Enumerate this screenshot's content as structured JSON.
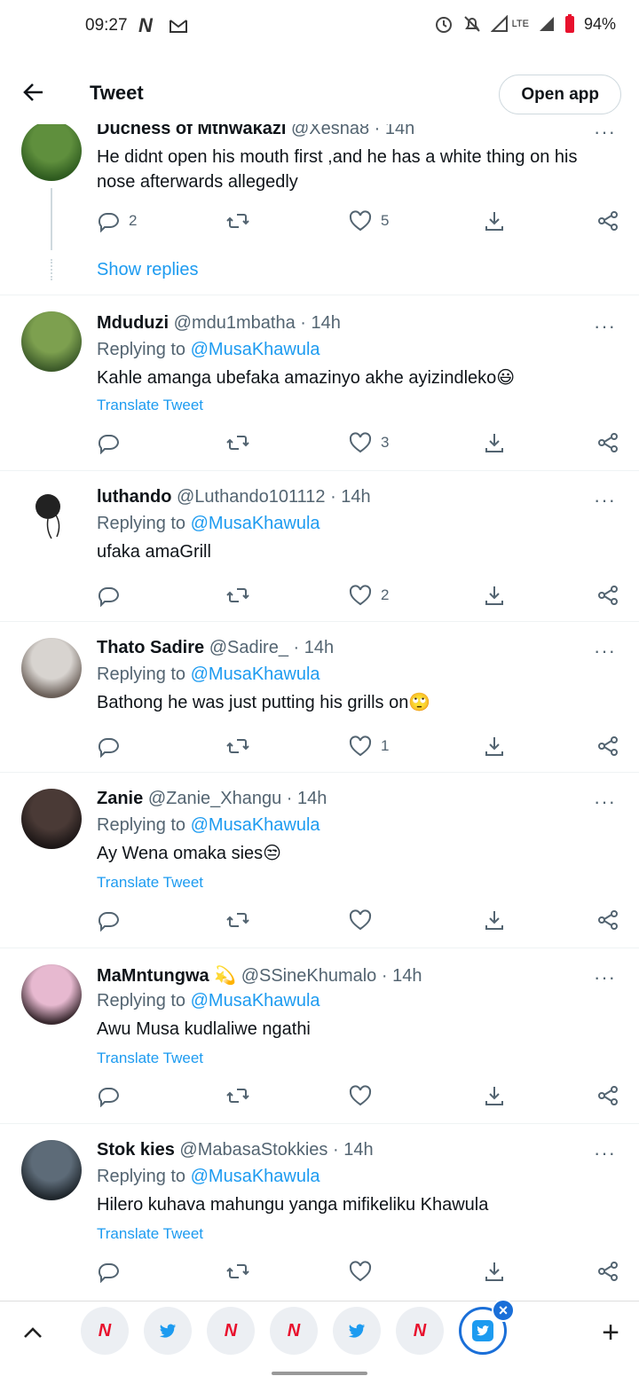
{
  "status_bar": {
    "time": "09:27",
    "app_icons": [
      "news-app-icon",
      "gmail-icon"
    ],
    "network": "LTE",
    "battery": "94%"
  },
  "header": {
    "title": "Tweet",
    "open_app_label": "Open app"
  },
  "tweets": [
    {
      "name": "Duchess of Mthwakazi",
      "handle": "@Xesha8",
      "time": "· 14h",
      "replying_prefix": "",
      "replying_to": "",
      "text": "He didnt open his mouth  first ,and he has a white thing on his nose afterwards allegedly",
      "translate": "",
      "replies": "2",
      "retweets": "",
      "likes": "5",
      "show_replies": "Show replies",
      "avatar_colors": [
        "#5f8f3d",
        "#2e5b1f"
      ]
    },
    {
      "name": "Mduduzi",
      "handle": "@mdu1mbatha",
      "time": "· 14h",
      "replying_prefix": "Replying to",
      "replying_to": "@MusaKhawula",
      "text": "Kahle amanga ubefaka amazinyo akhe ayizindleko😃",
      "translate": "Translate Tweet",
      "replies": "",
      "retweets": "",
      "likes": "3",
      "avatar_colors": [
        "#7da04f",
        "#3d5b2a"
      ]
    },
    {
      "name": "luthando",
      "handle": "@Luthando101112",
      "time": "· 14h",
      "replying_prefix": "Replying to",
      "replying_to": "@MusaKhawula",
      "text": "ufaka amaGrill",
      "translate": "",
      "replies": "",
      "retweets": "",
      "likes": "2",
      "avatar_colors": [
        "#ffffff",
        "#222222"
      ]
    },
    {
      "name": "Thato Sadire",
      "handle": "@Sadire_",
      "time": "· 14h",
      "replying_prefix": "Replying to",
      "replying_to": "@MusaKhawula",
      "text": "Bathong he was just putting his grills on🙄",
      "translate": "",
      "replies": "",
      "retweets": "",
      "likes": "1",
      "avatar_colors": [
        "#d8d4d0",
        "#6a5f58"
      ]
    },
    {
      "name": "Zanie",
      "handle": "@Zanie_Xhangu",
      "time": "· 14h",
      "replying_prefix": "Replying to",
      "replying_to": "@MusaKhawula",
      "text": "Ay Wena omaka sies😒",
      "translate": "Translate Tweet",
      "replies": "",
      "retweets": "",
      "likes": "",
      "avatar_colors": [
        "#4a3a36",
        "#1c1616"
      ]
    },
    {
      "name": "MaMntungwa",
      "handle": "@SSineKhumalo",
      "time": "· 14h",
      "replying_prefix": "Replying to",
      "replying_to": "@MusaKhawula",
      "text": "Awu Musa kudlaliwe ngathi",
      "translate": "Translate Tweet",
      "replies": "",
      "retweets": "",
      "likes": "",
      "badge_emoji": "💫",
      "avatar_colors": [
        "#e7b9d0",
        "#3a2a30"
      ]
    },
    {
      "name": "Stok kies",
      "handle": "@MabasaStokkies",
      "time": "· 14h",
      "replying_prefix": "Replying to",
      "replying_to": "@MusaKhawula",
      "text": "Hilero kuhava mahungu yanga mifikeliku Khawula",
      "translate": "Translate Tweet",
      "replies": "",
      "retweets": "",
      "likes": "",
      "avatar_colors": [
        "#5d6b78",
        "#1f262c"
      ]
    }
  ],
  "bottom_bar": {
    "tabs": [
      "news",
      "twitter",
      "news",
      "news",
      "twitter",
      "news",
      "twitter-active"
    ],
    "news_glyph": "N",
    "close_glyph": "×",
    "plus_glyph": "+"
  },
  "colors": {
    "twitter_blue": "#1d9bf0",
    "news_red": "#e8112d",
    "active_tab_border": "#1a6fd8"
  }
}
